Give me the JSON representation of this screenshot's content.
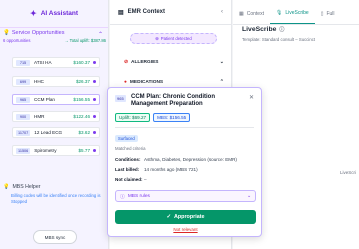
{
  "ai": {
    "title": "AI Assistant",
    "service_opps": {
      "title": "Service Opportunities",
      "count": "6 opportunities",
      "total": "→ Total uplift: $387.86"
    },
    "items": [
      {
        "code": "715",
        "label": "ATSI HA",
        "amount": "$160.37"
      },
      {
        "code": "699",
        "label": "HHC",
        "amount": "$26.37"
      },
      {
        "code": "965",
        "label": "CCM Plan",
        "amount": "$156.55"
      },
      {
        "code": "900",
        "label": "HMR",
        "amount": "$122.46"
      },
      {
        "code": "11707",
        "label": "12 Lead ECG",
        "amount": "$3.62"
      },
      {
        "code": "11506",
        "label": "Spirometry",
        "amount": "$5.77"
      }
    ],
    "mbs_helper": {
      "title": "MBS Helper",
      "desc": "Billing codes will be identified once recording is Stopped"
    },
    "sync_label": "MBS sync"
  },
  "emr": {
    "title": "EMR Context",
    "patient_pill": "Patient detected",
    "sections": [
      "ALLERGIES",
      "MEDICATIONS"
    ]
  },
  "right": {
    "tabs": [
      "Context",
      "LiveScribe",
      "Full"
    ],
    "title": "LiveScribe",
    "subtitle": "Template: Standard consult – Succinct",
    "side_label": "LiveScri"
  },
  "popup": {
    "code": "965",
    "title": "CCM Plan: Chronic Condition Management Preparation",
    "uplift": "Uplift: $69.27",
    "mbs": "MBS: $156.55",
    "badge": "Surfaced",
    "matched": "Matched criteria",
    "conditions_k": "Conditions:",
    "conditions_v": "Asthma, Diabetes, Depression (source: EMR)",
    "last_k": "Last billed:",
    "last_v": "14 months ago (MBS 721)",
    "notclaimed_k": "Not claimed:",
    "notclaimed_v": "–",
    "rules": "MBS rules",
    "appropriate": "Appropriate",
    "not_relevant": "Not relevant"
  }
}
